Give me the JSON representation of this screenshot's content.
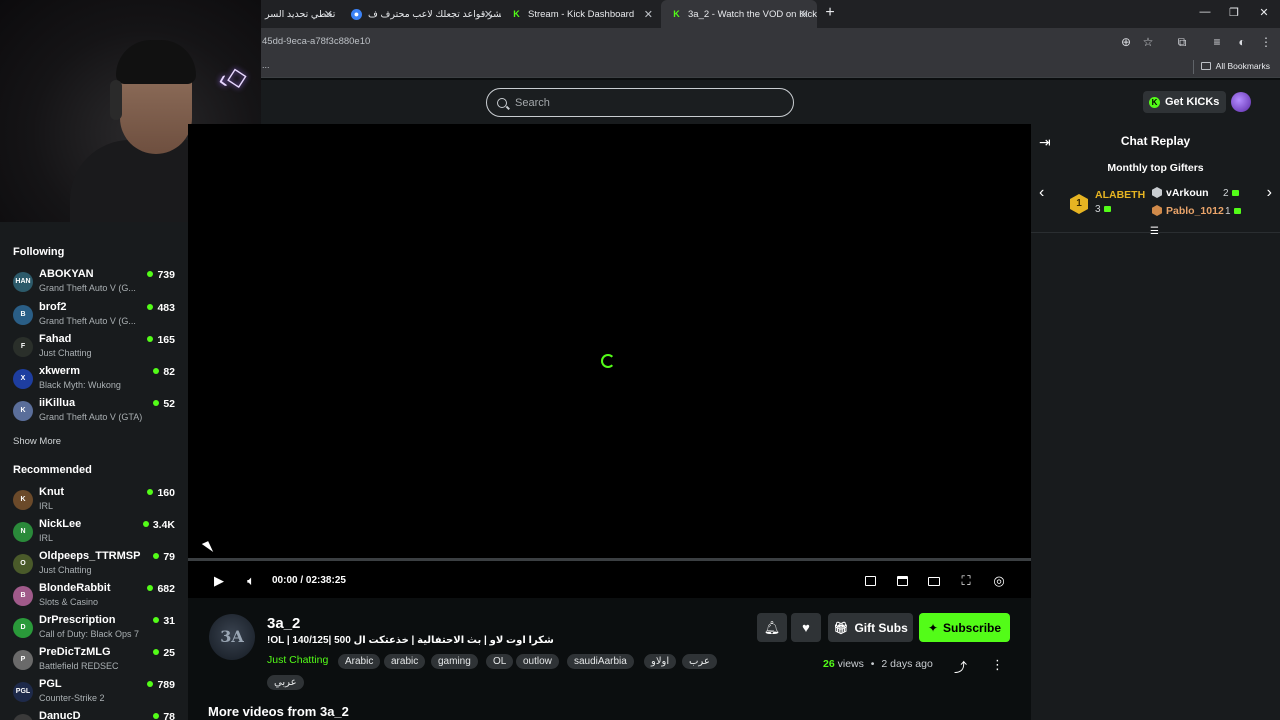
{
  "browser": {
    "tabs": [
      {
        "label": "تخطي تحديد السر"
      },
      {
        "label": "عشر قواعد تجعلك لاعب محترف ف"
      },
      {
        "label": "Stream - Kick Dashboard"
      },
      {
        "label": "3a_2 - Watch the VOD on Kick"
      }
    ],
    "url": "45dd-9eca-a78f3c880e10",
    "bookmarks_label": "All Bookmarks",
    "bookmark_stub": "..."
  },
  "nav": {
    "search_placeholder": "Search",
    "get_kicks": "Get KICKs"
  },
  "sidebar": {
    "following_title": "Following",
    "following": [
      {
        "name": "ABOKYAN",
        "category": "Grand Theft Auto V (G...",
        "viewers": "739",
        "avatar": "HAN",
        "color": "#2c5a6a"
      },
      {
        "name": "brof2",
        "category": "Grand Theft Auto V (G...",
        "viewers": "483",
        "avatar": "B",
        "color": "#2a5e86"
      },
      {
        "name": "Fahad",
        "category": "Just Chatting",
        "viewers": "165",
        "avatar": "F",
        "color": "#2a2f2a"
      },
      {
        "name": "xkwerm",
        "category": "Black Myth: Wukong",
        "viewers": "82",
        "avatar": "X",
        "color": "#1e3ea0"
      },
      {
        "name": "iiKillua",
        "category": "Grand Theft Auto V (GTA)",
        "viewers": "52",
        "avatar": "K",
        "color": "#5a6e9a"
      }
    ],
    "show_more": "Show More",
    "recommended_title": "Recommended",
    "recommended": [
      {
        "name": "Knut",
        "category": "IRL",
        "viewers": "160",
        "avatar": "K",
        "color": "#6b4a2a"
      },
      {
        "name": "NickLee",
        "category": "IRL",
        "viewers": "3.4K",
        "avatar": "N",
        "color": "#2a8a3a"
      },
      {
        "name": "Oldpeeps_TTRMSP",
        "category": "Just Chatting",
        "viewers": "79",
        "avatar": "O",
        "color": "#4a5a2a"
      },
      {
        "name": "BlondeRabbit",
        "category": "Slots & Casino",
        "viewers": "682",
        "avatar": "B",
        "color": "#a05a8a"
      },
      {
        "name": "DrPrescription",
        "category": "Call of Duty: Black Ops 7",
        "viewers": "31",
        "avatar": "D",
        "color": "#2a9a3a"
      },
      {
        "name": "PreDicTzMLG",
        "category": "Battlefield REDSEC",
        "viewers": "25",
        "avatar": "P",
        "color": "#6a6a6a"
      },
      {
        "name": "PGL",
        "category": "Counter-Strike 2",
        "viewers": "789",
        "avatar": "PGL",
        "color": "#1e2a4a"
      },
      {
        "name": "DanucD",
        "category": "",
        "viewers": "78",
        "avatar": "D",
        "color": "#3a3a3a"
      }
    ]
  },
  "player": {
    "current_time": "00:00",
    "separator": "/",
    "duration": "02:38:25",
    "progress": 0
  },
  "chat": {
    "title": "Chat Replay",
    "monthly_title": "Monthly top Gifters",
    "top_gifter": {
      "rank": "1",
      "name": "ALABETH",
      "count": "3"
    },
    "gifter_2": {
      "name": "vArkoun",
      "count": "2"
    },
    "gifter_3": {
      "name": "Pablo_1012",
      "count": "1"
    }
  },
  "video_info": {
    "channel_avatar": "3A",
    "channel": "3a_2",
    "title": "!OL | 140/125| شكرا اوت لاو | بث الاحتفالية | خذعتكت ال 500",
    "category": "Just Chatting",
    "tags": [
      "Arabic",
      "arabic",
      "gaming",
      "OL",
      "outlow",
      "saudiAarbia",
      "اولاو",
      "عرب",
      "عربي"
    ],
    "gift_subs": "Gift Subs",
    "subscribe": "Subscribe",
    "views_count": "26",
    "views_label": "views",
    "dot": "•",
    "posted": "2 days ago",
    "more_videos": "More videos from 3a_2"
  },
  "colors": {
    "accent": "#53fc18",
    "bg": "#0b0e0f",
    "panel": "#181b1d"
  }
}
